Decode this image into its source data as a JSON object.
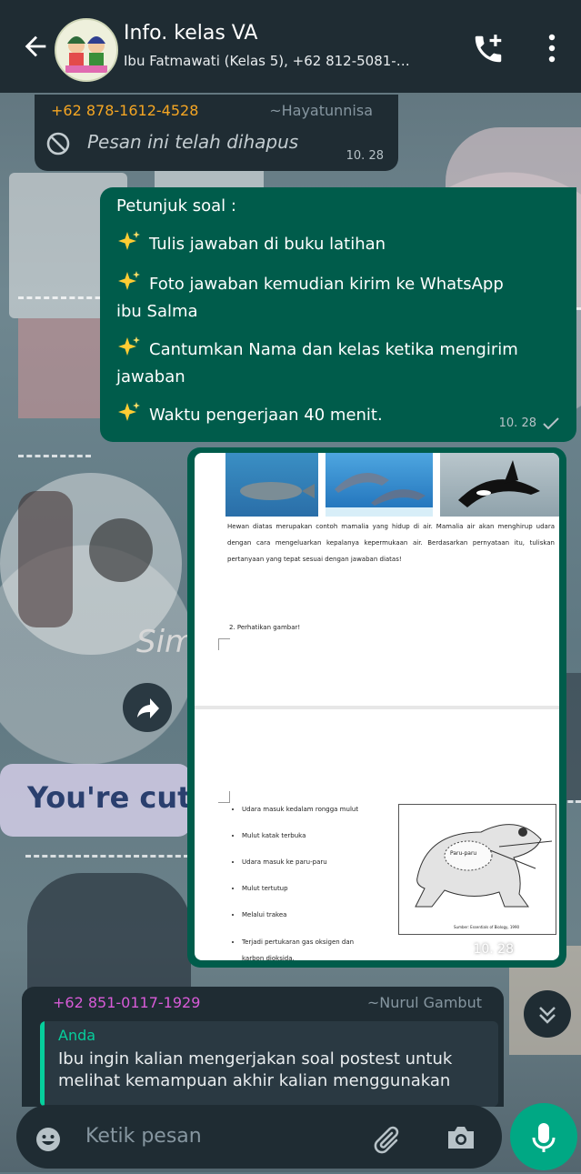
{
  "chat": {
    "title": "Info. kelas VA",
    "subtitle": "Ibu Fatmawati (Kelas 5), +62 812-5081-…"
  },
  "messages": [
    {
      "sender_phone": "+62 878-1612-4528",
      "sender_name": "~Hayatunnisa",
      "text": "Pesan ini telah dihapus",
      "time": "10. 28"
    },
    {
      "lines": [
        "Petunjuk soal :",
        "Tulis jawaban di buku latihan",
        "Foto jawaban kemudian kirim ke WhatsApp",
        "ibu Salma",
        "Cantumkan Nama dan kelas ketika mengirim",
        "jawaban",
        "Waktu pengerjaan 40 menit."
      ],
      "time": "10. 28"
    },
    {
      "image": {
        "caption": "Hewan diatas merupakan contoh mamalia yang hidup di air. Mamalia air akan menghirup udara dengan cara mengeluarkan kepalanya kepermukaan air. Berdasarkan pernyataan itu, tuliskan pertanyaan yang tepat sesuai dengan jawaban diatas!",
        "question2": "2. Perhatikan gambar!",
        "bullets": [
          "Udara masuk kedalam rongga mulut",
          "Mulut katak terbuka",
          "Udara masuk ke paru-paru",
          "Mulut tertutup",
          "Melalui trakea",
          "Terjadi pertukaran gas oksigen dan",
          "karbon dioksida."
        ],
        "frog_label": "Paru-paru",
        "frog_source": "Sumber: Essentials of Biology, 1990"
      },
      "time": "10. 28"
    },
    {
      "sender_phone": "+62 851-0117-1929",
      "sender_name": "~Nurul Gambut",
      "quote_author": "Anda",
      "quote_text": "Ibu ingin kalian mengerjakan soal postest untuk melihat kemampuan akhir kalian menggunakan"
    }
  ],
  "wallpaper": {
    "text_cute": "You're cute",
    "text_sim": "Sim"
  },
  "composer": {
    "placeholder": "Ketik pesan"
  },
  "colors": {
    "header": "#1f2c33",
    "outgoing": "#005c4b",
    "incoming": "#1f2c33",
    "accent": "#00a884"
  }
}
